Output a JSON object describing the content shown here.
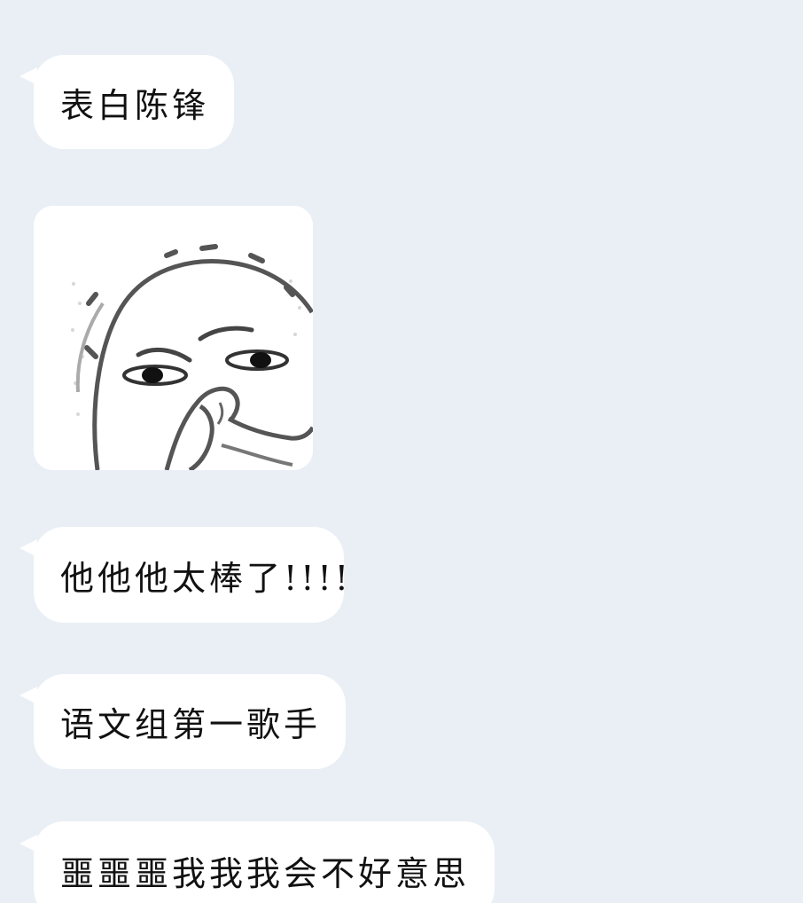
{
  "chat": {
    "messages": [
      {
        "type": "text",
        "text": "表白陈锋"
      },
      {
        "type": "sticker",
        "icon": "covering-nose-meme-sticker"
      },
      {
        "type": "text",
        "text": "他他他太棒了!!!!"
      },
      {
        "type": "text",
        "text": "语文组第一歌手"
      },
      {
        "type": "text",
        "text": "噩噩噩我我我会不好意思"
      }
    ]
  },
  "colors": {
    "background": "#e9eff5",
    "bubble": "#ffffff",
    "text": "#111111"
  }
}
